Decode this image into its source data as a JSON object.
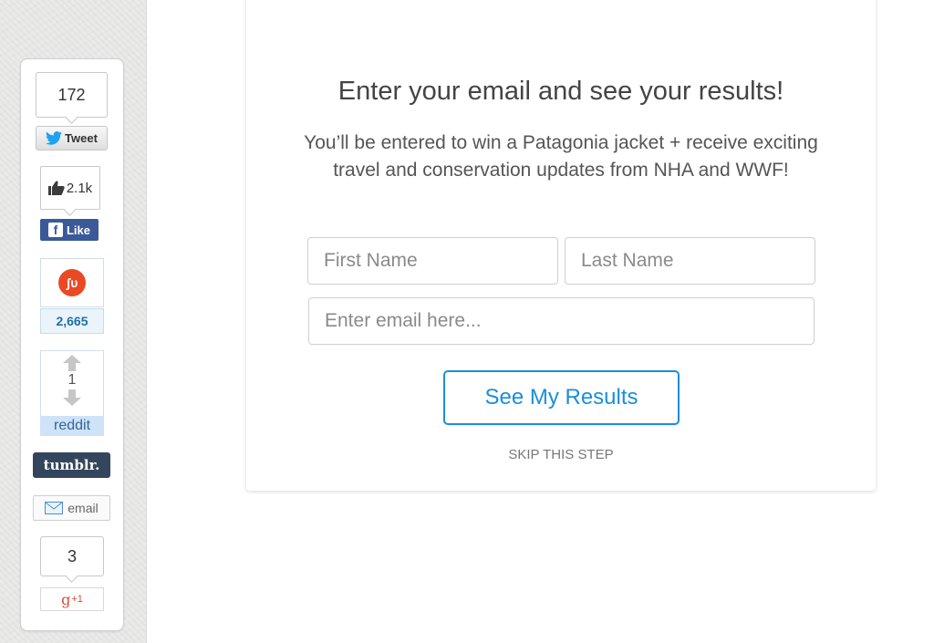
{
  "share": {
    "twitter": {
      "count": "172",
      "label": "Tweet"
    },
    "facebook": {
      "count": "2.1k",
      "label": "Like"
    },
    "stumbleupon": {
      "count": "2,665"
    },
    "reddit": {
      "score": "1",
      "label": "reddit"
    },
    "tumblr": {
      "label": "tumblr."
    },
    "email": {
      "label": "email"
    },
    "googleplus": {
      "count": "3",
      "label": "+1",
      "glyph": "g"
    }
  },
  "signup": {
    "heading": "Enter your email and see your results!",
    "subtext": "You’ll be entered to win a Patagonia jacket + receive exciting travel and conservation updates from NHA and WWF!",
    "first_name_placeholder": "First Name",
    "last_name_placeholder": "Last Name",
    "email_placeholder": "Enter email here...",
    "submit_label": "See My Results",
    "skip_label": "SKIP THIS STEP"
  },
  "colors": {
    "accent": "#1a8fd9",
    "facebook": "#3b5998",
    "stumbleupon": "#eb4924",
    "tumblr": "#34465d",
    "reddit_label_bg": "#cee3f8",
    "googleplus": "#dd4b39"
  }
}
